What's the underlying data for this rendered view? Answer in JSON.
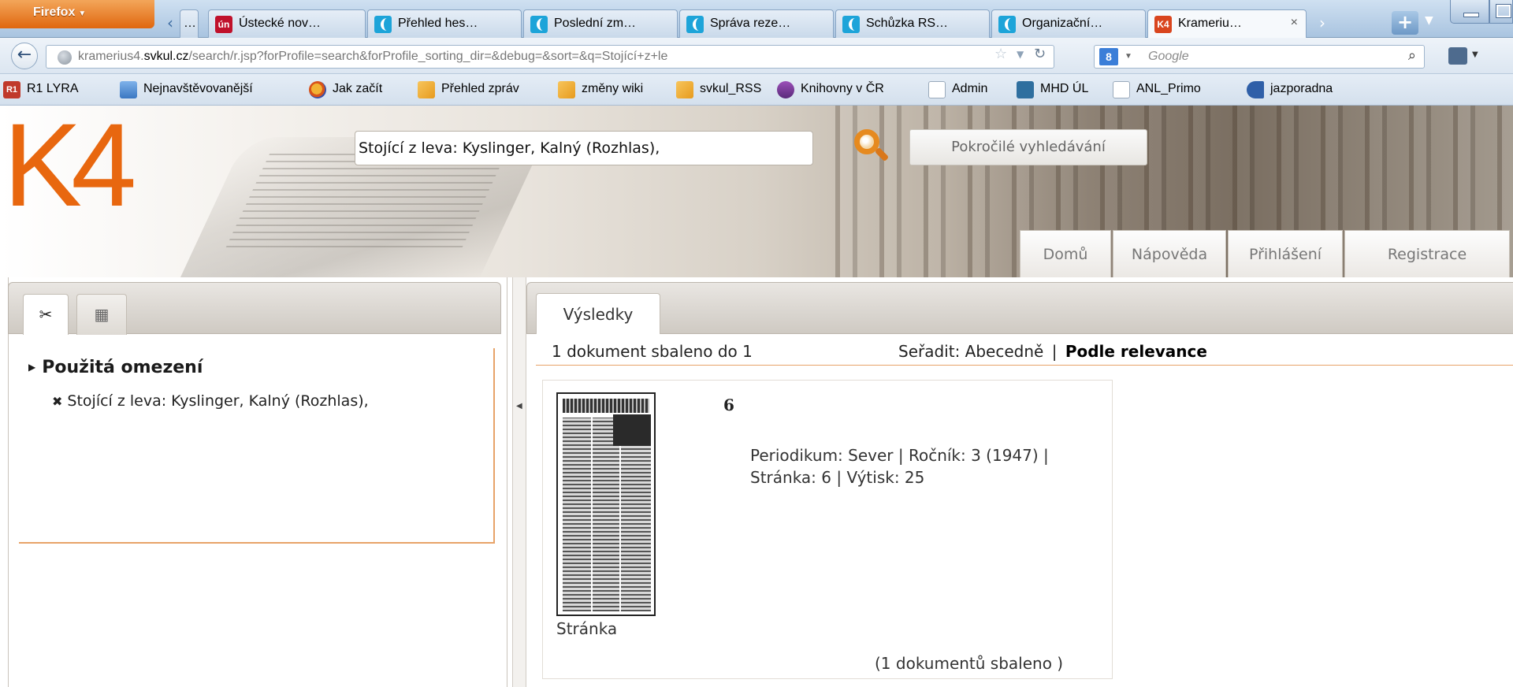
{
  "browser": {
    "menu_button": "Firefox",
    "tabs": [
      {
        "label": "…",
        "icon": "tab-overflow"
      },
      {
        "label": "Ústecké nov…",
        "icon": "un-favicon"
      },
      {
        "label": "Přehled hes…",
        "icon": "confluence-favicon"
      },
      {
        "label": "Poslední zm…",
        "icon": "confluence-favicon"
      },
      {
        "label": "Správa reze…",
        "icon": "confluence-favicon"
      },
      {
        "label": "Schůzka RS…",
        "icon": "confluence-favicon"
      },
      {
        "label": "Organizační…",
        "icon": "confluence-favicon"
      },
      {
        "label": "Krameriu…",
        "icon": "k4-favicon",
        "active": true
      }
    ],
    "tab_close": "×",
    "url_domain_prefix": "kramerius4.",
    "url_domain": "svkul.cz",
    "url_path": "/search/r.jsp?forProfile=search&forProfile_sorting_dir=&debug=&sort=&q=Stojící+z+le",
    "search_placeholder": "Google",
    "search_engine_icon": "8"
  },
  "bookmarks": [
    {
      "label": "R1 LYRA",
      "icon": "r1-icon"
    },
    {
      "label": "Nejnavštěvovanější",
      "icon": "blue-icon"
    },
    {
      "label": "Jak začít",
      "icon": "firefox-icon"
    },
    {
      "label": "Přehled zpráv",
      "icon": "rss-icon"
    },
    {
      "label": "změny wiki",
      "icon": "rss-icon"
    },
    {
      "label": "svkul_RSS",
      "icon": "rss-icon"
    },
    {
      "label": "Knihovny v ČR",
      "icon": "book-icon"
    },
    {
      "label": "Admin",
      "icon": "blank-icon"
    },
    {
      "label": "MHD ÚL",
      "icon": "grid-icon"
    },
    {
      "label": "ANL_Primo",
      "icon": "blank-icon"
    },
    {
      "label": "jazporadna",
      "icon": "jaz-icon"
    }
  ],
  "site": {
    "logo": "K4",
    "query": "Stojící z leva: Kyslinger, Kalný (Rozhlas),",
    "advanced_search": "Pokročilé vyhledávání",
    "nav": [
      "Domů",
      "Nápověda",
      "Přihlášení",
      "Registrace"
    ],
    "accent_color": "#e8670f"
  },
  "left_panel": {
    "tabs": [
      "✂",
      "▦"
    ],
    "filters_title": "Použitá omezení",
    "filter_remove": "✖",
    "filter_value": "Stojící z leva: Kyslinger, Kalný (Rozhlas),"
  },
  "results": {
    "tab": "Výsledky",
    "count_text": "1 dokument  sbaleno do 1",
    "sort_label": "Seřadit:",
    "sort_alpha": "Abecedně",
    "sort_sep": "|",
    "sort_relevance": "Podle relevance",
    "doc": {
      "title": "6",
      "meta": "Periodikum: Sever  |  Ročník: 3 (1947)  |  Stránka: 6     |  Výtisk: 25",
      "type": "Stránka",
      "collapsed": "(1 dokumentů sbaleno )"
    }
  }
}
